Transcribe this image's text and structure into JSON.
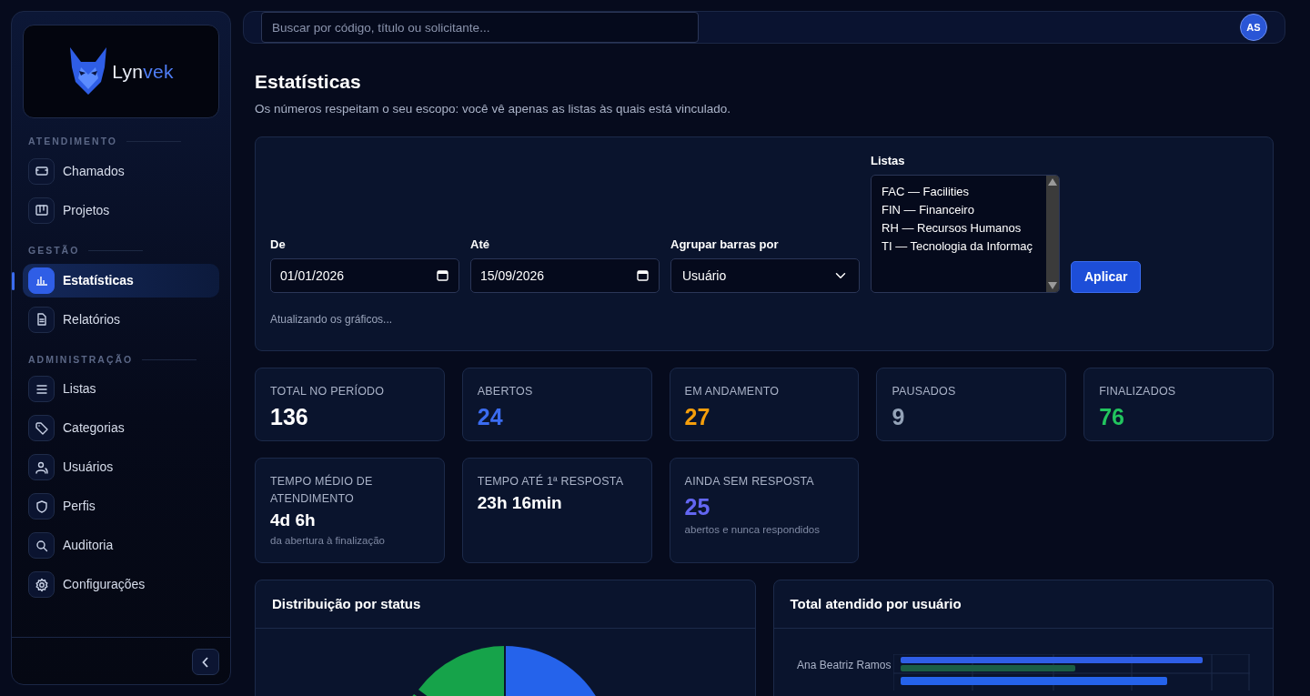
{
  "brand": {
    "prefix": "Lyn",
    "accent": "vek"
  },
  "sidebar": {
    "sections": [
      {
        "title": "ATENDIMENTO",
        "items": [
          {
            "label": "Chamados",
            "selected": false
          },
          {
            "label": "Projetos",
            "selected": false
          }
        ]
      },
      {
        "title": "GESTÃO",
        "items": [
          {
            "label": "Estatísticas",
            "selected": true
          },
          {
            "label": "Relatórios",
            "selected": false
          }
        ]
      },
      {
        "title": "ADMINISTRAÇÃO",
        "items": [
          {
            "label": "Listas",
            "selected": false
          },
          {
            "label": "Categorias",
            "selected": false
          },
          {
            "label": "Usuários",
            "selected": false
          },
          {
            "label": "Perfis",
            "selected": false
          },
          {
            "label": "Auditoria",
            "selected": false
          },
          {
            "label": "Configurações",
            "selected": false
          }
        ]
      }
    ]
  },
  "search": {
    "placeholder": "Buscar por código, título ou solicitante..."
  },
  "avatar": "AS",
  "page": {
    "title": "Estatísticas",
    "subtitle": "Os números respeitam o seu escopo: você vê apenas as listas às quais está vinculado."
  },
  "filters": {
    "from": {
      "label": "De",
      "value": "01/01/2026"
    },
    "to": {
      "label": "Até",
      "value": "15/09/2026"
    },
    "group_by": {
      "label": "Agrupar barras por",
      "value": "Usuário"
    },
    "lists": {
      "label": "Listas",
      "options": [
        {
          "label": "FAC — Facilities",
          "selected": false
        },
        {
          "label": "FIN — Financeiro",
          "selected": false
        },
        {
          "label": "RH — Recursos Humanos",
          "selected": false
        },
        {
          "label": "TI — Tecnologia da Informaç",
          "selected": false
        }
      ]
    },
    "apply": "Aplicar",
    "status": "Atualizando os gráficos..."
  },
  "stats": [
    {
      "label": "TOTAL NO PERÍODO",
      "value": "136",
      "color": "#ffffff"
    },
    {
      "label": "ABERTOS",
      "value": "24",
      "color": "#3b6cf0"
    },
    {
      "label": "EM ANDAMENTO",
      "value": "27",
      "color": "#f59e0b"
    },
    {
      "label": "PAUSADOS",
      "value": "9",
      "color": "#94a3b8"
    },
    {
      "label": "FINALIZADOS",
      "value": "76",
      "color": "#22c55e"
    }
  ],
  "metrics": [
    {
      "label": "TEMPO MÉDIO DE ATENDIMENTO",
      "value": "4d 6h",
      "note": "da abertura à finalização",
      "color": "#ffffff"
    },
    {
      "label": "TEMPO ATÉ 1ª RESPOSTA",
      "value": "23h 16min",
      "color": "#ffffff"
    },
    {
      "label": "AINDA SEM RESPOSTA",
      "value": "25",
      "note": "abertos e nunca respondidos",
      "color": "#6366f1"
    }
  ],
  "charts": [
    {
      "title": "Distribuição por status",
      "kind": "pie"
    },
    {
      "title": "Total atendido por usuário",
      "kind": "bars",
      "row_labels": [
        "Ana Beatriz Ramos"
      ]
    }
  ]
}
